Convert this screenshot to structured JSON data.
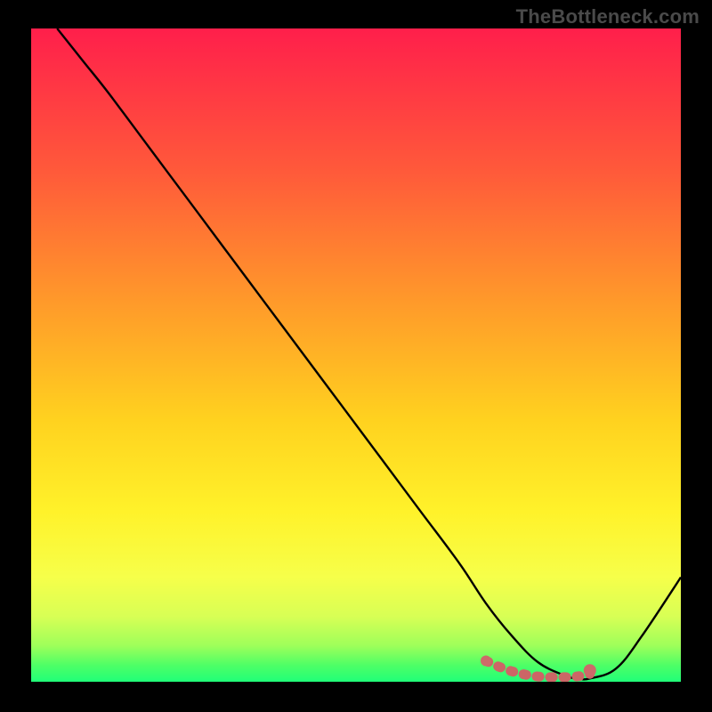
{
  "watermark": "TheBottleneck.com",
  "colors": {
    "page_bg": "#000000",
    "curve_stroke": "#000000",
    "pink_stroke": "#cc6666",
    "pink_fill": "#cd6a69",
    "gradient_stops": [
      {
        "offset": 0.0,
        "color": "#ff1f4b"
      },
      {
        "offset": 0.22,
        "color": "#ff5a3a"
      },
      {
        "offset": 0.42,
        "color": "#ff9a2a"
      },
      {
        "offset": 0.6,
        "color": "#ffd21f"
      },
      {
        "offset": 0.74,
        "color": "#fff22a"
      },
      {
        "offset": 0.84,
        "color": "#f6ff4a"
      },
      {
        "offset": 0.9,
        "color": "#d8ff55"
      },
      {
        "offset": 0.945,
        "color": "#9eff5a"
      },
      {
        "offset": 0.975,
        "color": "#4dff66"
      },
      {
        "offset": 1.0,
        "color": "#20ff78"
      }
    ]
  },
  "chart_data": {
    "type": "line",
    "title": "",
    "xlabel": "",
    "ylabel": "",
    "xlim": [
      0,
      100
    ],
    "ylim": [
      0,
      100
    ],
    "grid": false,
    "series": [
      {
        "name": "bottleneck_curve",
        "x": [
          4,
          8,
          12,
          18,
          24,
          30,
          36,
          42,
          48,
          54,
          60,
          66,
          70,
          74,
          78,
          82,
          84,
          86,
          90,
          94,
          100
        ],
        "y": [
          100,
          95,
          90,
          82,
          74,
          66,
          58,
          50,
          42,
          34,
          26,
          18,
          12,
          7,
          3,
          1,
          0.5,
          0.5,
          2,
          7,
          16
        ]
      }
    ],
    "highlight": {
      "name": "bottom_flat_dots",
      "x": [
        70,
        72,
        74,
        76,
        78,
        80,
        82,
        84,
        86
      ],
      "y": [
        3.2,
        2.3,
        1.6,
        1.1,
        0.8,
        0.7,
        0.7,
        0.8,
        1.2
      ]
    }
  }
}
